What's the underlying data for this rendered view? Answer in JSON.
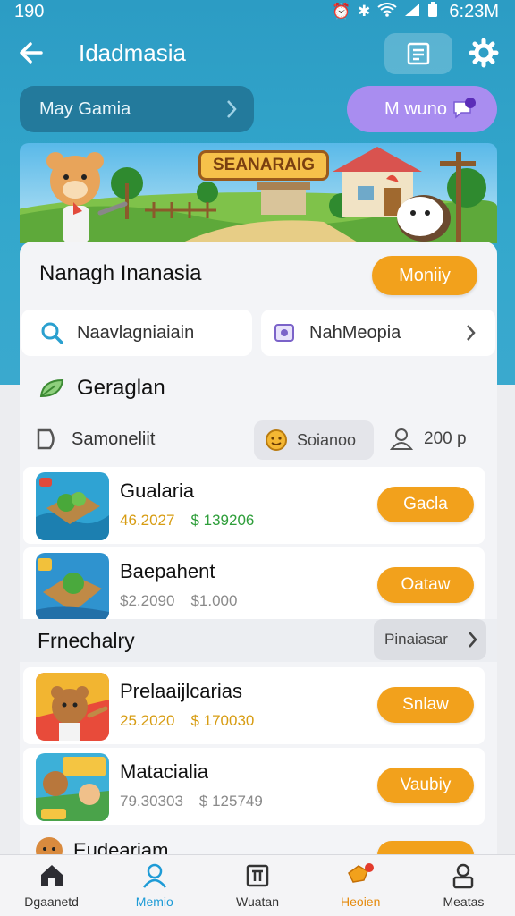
{
  "status": {
    "left": "190",
    "time": "6:23M"
  },
  "header": {
    "title": "Idadmasia"
  },
  "pills": {
    "left": "May Gamia",
    "right": "M wuno"
  },
  "banner": {
    "title": "SEANARAIG"
  },
  "section": {
    "title": "Nanagh Inanasia",
    "button": "Moniiy"
  },
  "search": {
    "placeholder": "Naavlagniaiain"
  },
  "media": {
    "label": "NahMeopia"
  },
  "category": {
    "label": "Geraglan"
  },
  "filter": {
    "left": "Samoneliit",
    "chip": "Soianoo",
    "count": "200 p"
  },
  "items": [
    {
      "title": "Gualaria",
      "date": "46.2027",
      "price": "$ 139206",
      "button": "Gacla",
      "date_color": "#d79c12",
      "price_color": "#2e9e3a"
    },
    {
      "title": "Baepahent",
      "date": "$2.2090",
      "price": "$1.000",
      "button": "Oataw",
      "date_color": "#8a8a8a",
      "price_color": "#8a8a8a"
    },
    {
      "title": "Prelaaijlcarias",
      "date": "25.2020",
      "price": "$ 170030",
      "button": "Snlaw",
      "date_color": "#d79c12",
      "price_color": "#d79c12"
    },
    {
      "title": "Matacialia",
      "date": "79.30303",
      "price": "$ 125749",
      "button": "Vaubiy",
      "date_color": "#8a8a8a",
      "price_color": "#8a8a8a"
    }
  ],
  "section2": {
    "title": "Frnechalry",
    "chip": "Pinaiasar"
  },
  "partial": {
    "title": "Eudearjam"
  },
  "nav": [
    {
      "label": "Dgaanetd",
      "icon": "home-icon"
    },
    {
      "label": "Memio",
      "icon": "profile-icon"
    },
    {
      "label": "Wuatan",
      "icon": "frame-icon"
    },
    {
      "label": "Heoien",
      "icon": "chat-icon"
    },
    {
      "label": "Meatas",
      "icon": "user-lock-icon"
    }
  ],
  "colors": {
    "primary": "#2c9cc4",
    "accent": "#f2a11c",
    "purple": "#a98df0",
    "nav_active": "#1e9bd6",
    "nav_orange": "#e58a0c"
  }
}
